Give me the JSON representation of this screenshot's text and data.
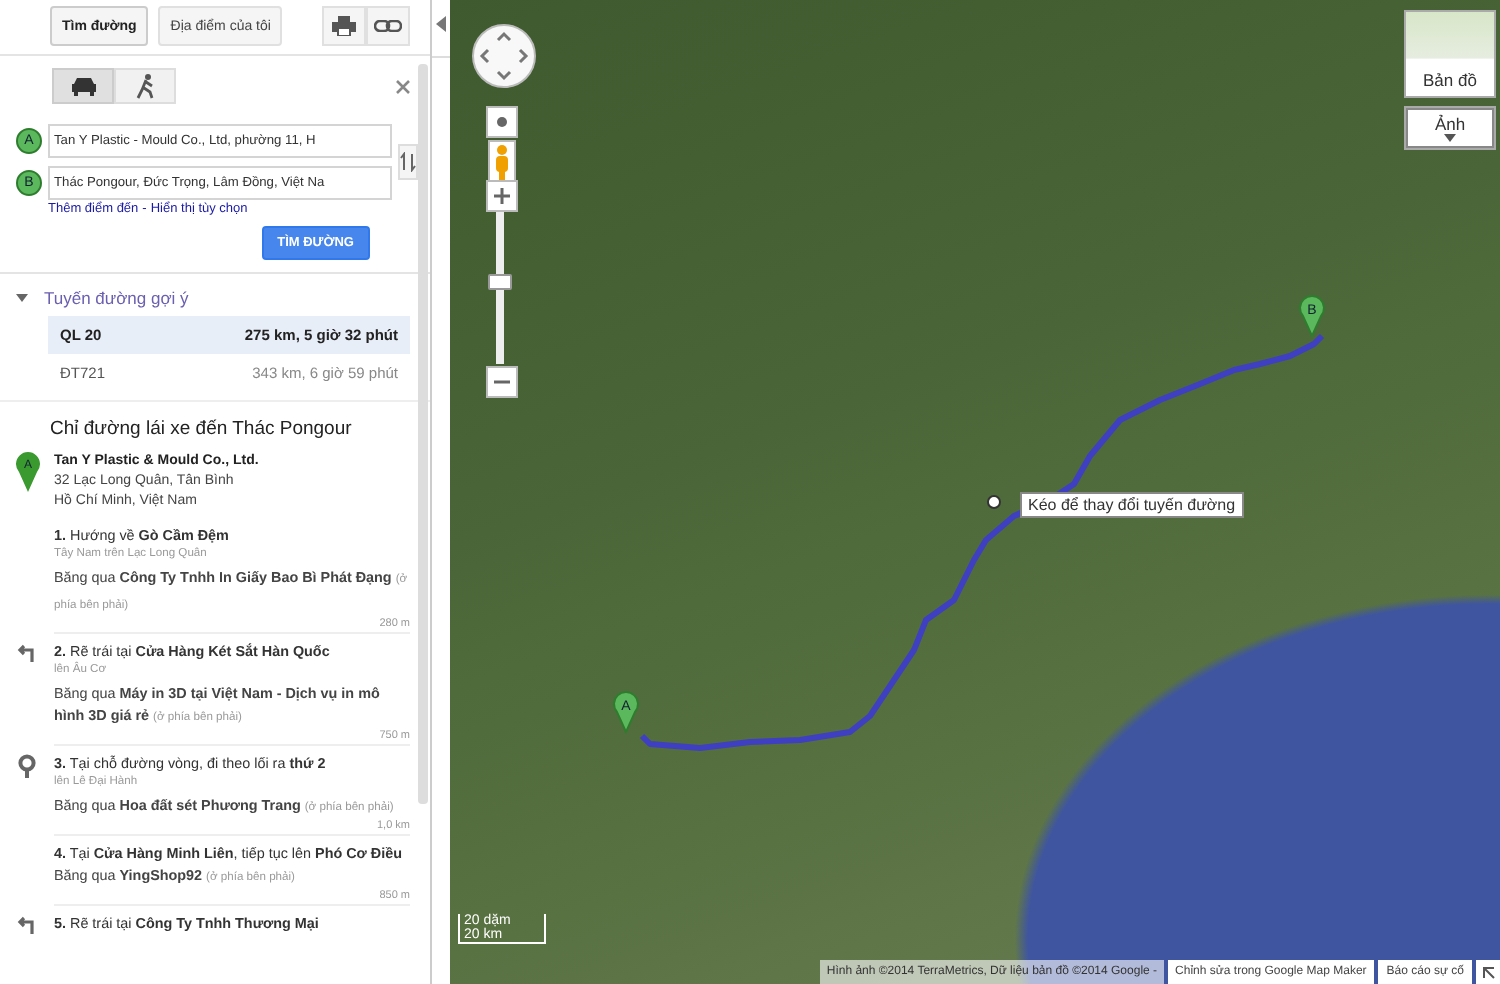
{
  "toolbar": {
    "buttons": [
      {
        "label": "Tìm đường",
        "selected": true
      },
      {
        "label": "Địa điểm của tôi",
        "selected": false
      }
    ]
  },
  "travel_modes": [
    {
      "kind": "car",
      "selected": true
    },
    {
      "kind": "walk",
      "selected": false
    }
  ],
  "waypoints": [
    {
      "marker": "A",
      "value": "Tan Y Plastic - Mould Co., Ltd, phường 11, H"
    },
    {
      "marker": "B",
      "value": "Thác Pongour, Đức Trọng, Lâm Đồng, Việt Na"
    }
  ],
  "links": [
    "Thêm điểm đến",
    "Hiển thị tùy chọn"
  ],
  "link_separator": "-",
  "search_button": "TÌM ĐƯỜNG",
  "routes": {
    "title": "Tuyến đường gợi ý",
    "expanded": true,
    "items": [
      {
        "name": "QL 20",
        "summary": "275 km, 5 giờ 32 phút",
        "selected": true
      },
      {
        "name": "ĐT721",
        "summary": "343 km, 6 giờ 59 phút",
        "selected": false
      }
    ]
  },
  "directions": {
    "title": "Chỉ đường lái xe đến Thác Pongour",
    "origin": {
      "marker": "A",
      "name": "Tan Y Plastic & Mould Co., Ltd.",
      "address": [
        "32 Lạc Long Quân, Tân Bình",
        "Hồ Chí Minh, Việt Nam"
      ]
    },
    "steps": [
      {
        "kind": "straight",
        "number": "1.",
        "text": "Hướng về **Gò Cầm Đệm**",
        "sub": "Tây Nam trên Lạc Long Quân",
        "pass": "Băng qua **Công Ty Tnhh In Giấy Bao Bì Phát Đạng**",
        "note": "(ở phía bên phải)",
        "distance": "280 m"
      },
      {
        "kind": "turn-left",
        "number": "2.",
        "text": "Rẽ trái tại **Cửa Hàng Két Sắt Hàn Quốc**",
        "sub": "lên Âu Cơ",
        "pass": "Băng qua **Máy in 3D tại Việt Nam - Dịch vụ in mô hình 3D giá rẻ**",
        "note": "(ở phía bên phải)",
        "distance": "750 m"
      },
      {
        "kind": "roundabout",
        "number": "3.",
        "text": "Tại chỗ đường vòng, đi theo lối ra **thứ 2**",
        "sub": "lên Lê Đại Hành",
        "pass": "Băng qua **Hoa đất sét Phương Trang**",
        "note": "(ở phía bên phải)",
        "distance": "1,0 km"
      },
      {
        "kind": "straight",
        "number": "4.",
        "text": "Tại **Cửa Hàng Minh Liên**, tiếp tục lên **Phó Cơ Điều**",
        "pass": "Băng qua **YingShop92**",
        "note": "(ở phía bên phải)",
        "distance": "850 m"
      },
      {
        "kind": "turn-left",
        "number": "5.",
        "text": "Rẽ trái tại **Công Ty Tnhh Thương Mại**"
      }
    ]
  },
  "map": {
    "tooltip": "Kéo để thay đổi tuyến đường",
    "zoom": {
      "level": 0.55
    },
    "map_types": [
      {
        "label": "Bản đồ",
        "selected": false
      },
      {
        "label": "Ảnh",
        "selected": true
      }
    ],
    "markers": [
      "A",
      "B"
    ],
    "scale": [
      "20 dặm",
      "20 km"
    ],
    "attribution": "Hình ảnh ©2014 TerraMetrics, Dữ liệu bản đồ ©2014 Google -",
    "footer_links": [
      "Chỉnh sửa trong Google Map Maker",
      "Báo cáo sự cố"
    ]
  }
}
